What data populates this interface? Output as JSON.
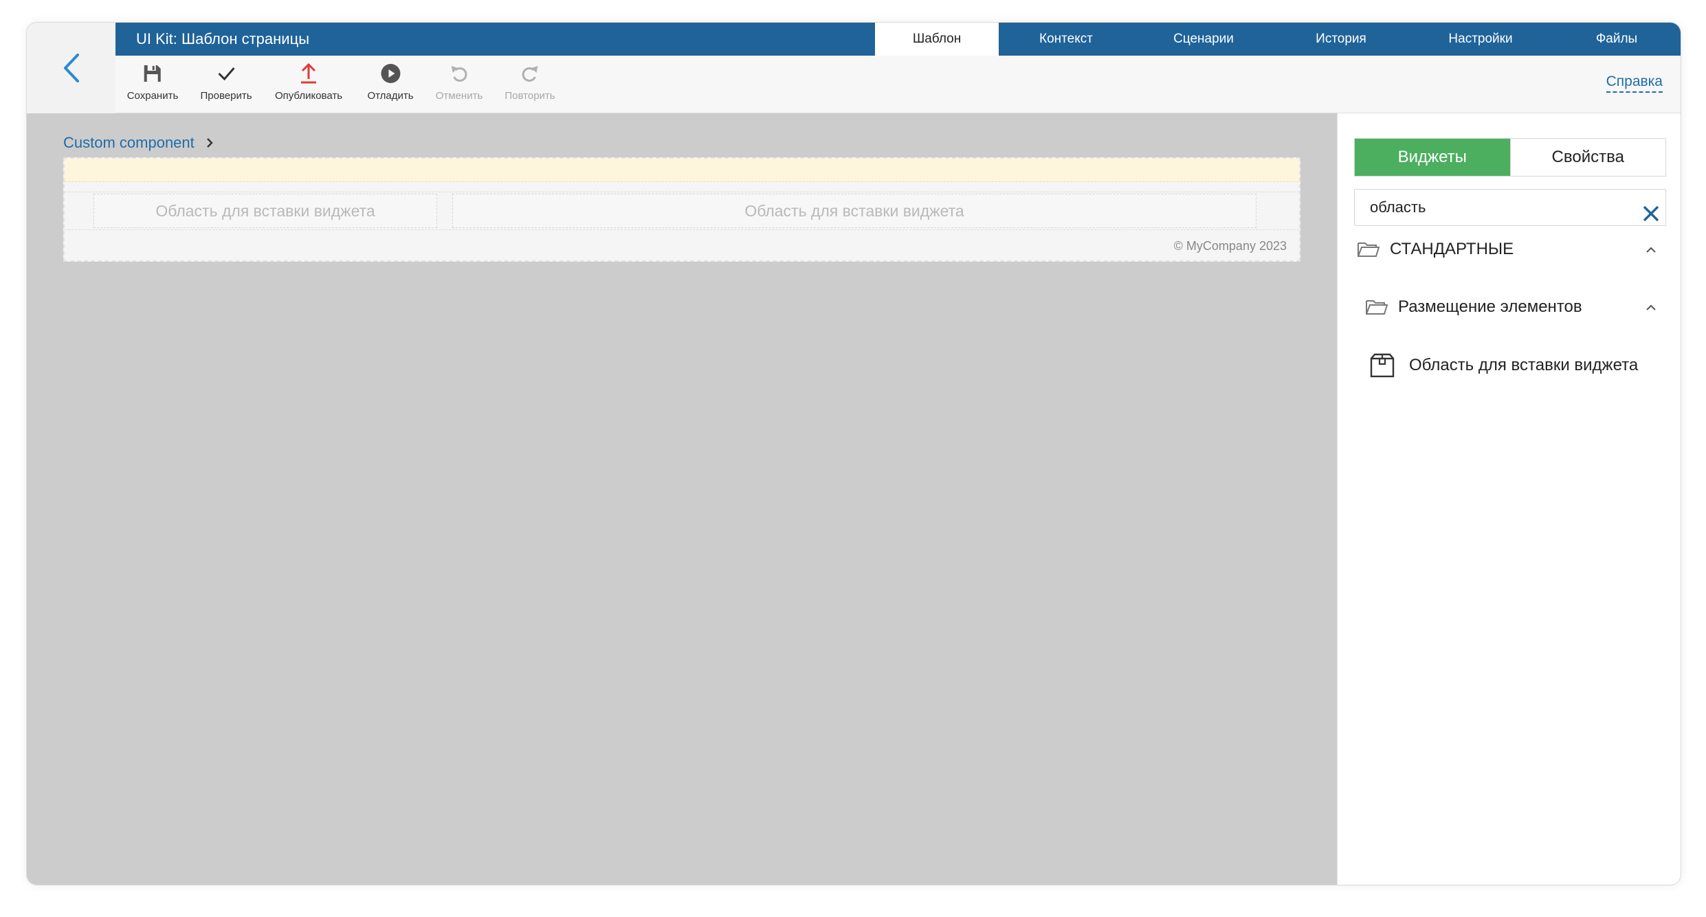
{
  "app": {
    "title": "UI Kit: Шаблон страницы",
    "help_label": "Справка"
  },
  "tabs": [
    {
      "label": "Шаблон",
      "active": true
    },
    {
      "label": "Контекст"
    },
    {
      "label": "Сценарии"
    },
    {
      "label": "История"
    },
    {
      "label": "Настройки"
    },
    {
      "label": "Файлы"
    }
  ],
  "toolbar": {
    "save": {
      "label": "Сохранить",
      "icon": "save-icon"
    },
    "check": {
      "label": "Проверить",
      "icon": "check-icon"
    },
    "publish": {
      "label": "Опубликовать",
      "icon": "upload-icon"
    },
    "debug": {
      "label": "Отладить",
      "icon": "play-icon"
    },
    "undo": {
      "label": "Отменить",
      "icon": "undo-icon",
      "disabled": true
    },
    "redo": {
      "label": "Повторить",
      "icon": "redo-icon",
      "disabled": true
    }
  },
  "canvas": {
    "breadcrumb": "Custom component",
    "drop_zone_1": "Область для вставки виджета",
    "drop_zone_2": "Область для вставки виджета",
    "footer": "© MyCompany 2023"
  },
  "side": {
    "tab_widgets": "Виджеты",
    "tab_properties": "Свойства",
    "search_value": "область",
    "group_standard": "СТАНДАРТНЫЕ",
    "group_layout": "Размещение элементов",
    "item_widget_area": "Область для вставки виджета"
  },
  "colors": {
    "topbar": "#1f6399",
    "accent_link": "#1f6ca8",
    "widgets_tab": "#4caf5f",
    "publish_icon": "#e03a3a",
    "canvas_bg": "#cccccc"
  }
}
